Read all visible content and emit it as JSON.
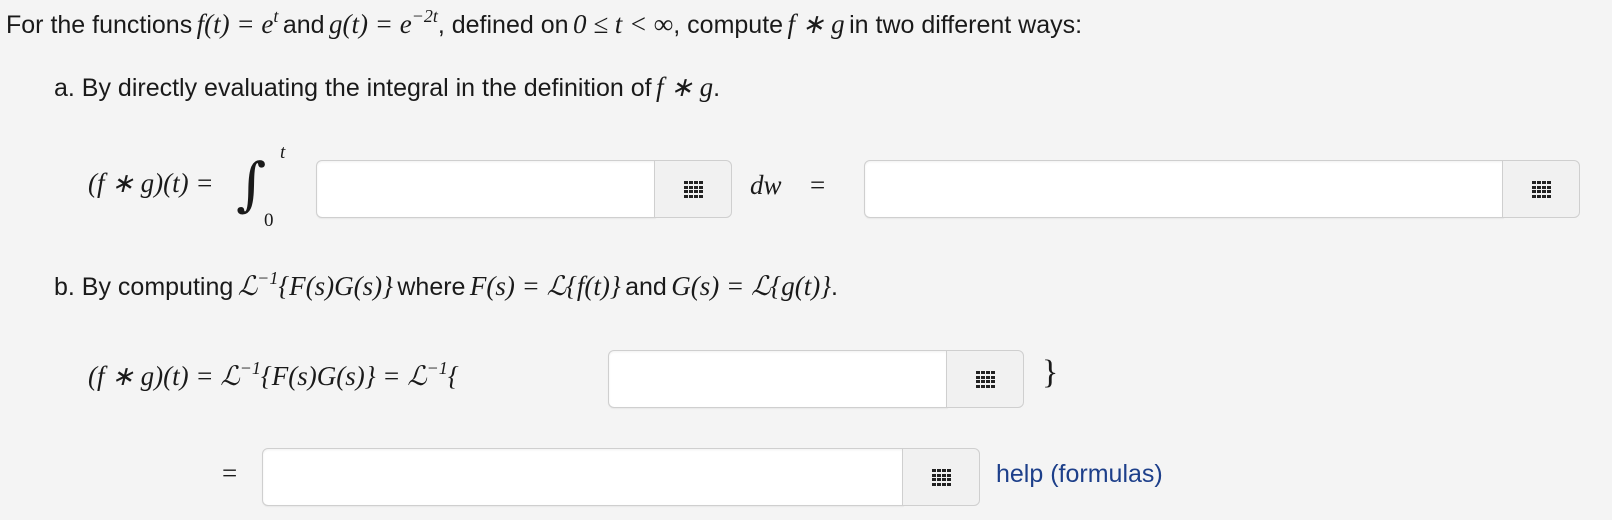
{
  "intro": {
    "lead": "For the functions",
    "f_def": "f(t) = e",
    "f_exp": "t",
    "and": "and",
    "g_def": "g(t) = e",
    "g_exp": "−2t",
    "mid": ", defined on",
    "domain": "0 ≤ t < ∞",
    "tail": ", compute",
    "conv": "f ∗ g",
    "end": "in two different ways:"
  },
  "part_a": {
    "text": "a. By directly evaluating the integral in the definition of",
    "conv": "f ∗ g",
    "period": ".",
    "lhs": "(f ∗ g)(t) =",
    "integral_sign": "∫",
    "upper": "t",
    "lower": "0",
    "dw": "dw",
    "equals": "=",
    "input1_value": "",
    "input2_value": ""
  },
  "part_b": {
    "text1": "b. By computing",
    "expr1": "ℒ",
    "expr1_sup": "−1",
    "expr1_arg": "{F(s)G(s)}",
    "where": "where",
    "Fdef": "F(s) = ℒ{f(t)}",
    "and": "and",
    "Gdef": "G(s) = ℒ{g(t)}",
    "period": ".",
    "lhs": "(f ∗ g)(t) = ℒ",
    "lhs_sup": "−1",
    "lhs_arg": "{F(s)G(s)} = ℒ",
    "lhs_sup2": "−1",
    "open_brace": "{",
    "close_brace": "}",
    "input3_value": "",
    "equals2": "=",
    "input4_value": ""
  },
  "help_link": "help (formulas)",
  "icons": {
    "palette": "equation-palette-grid-icon"
  },
  "colors": {
    "background": "#f4f4f4",
    "link": "#1d3f8a"
  }
}
